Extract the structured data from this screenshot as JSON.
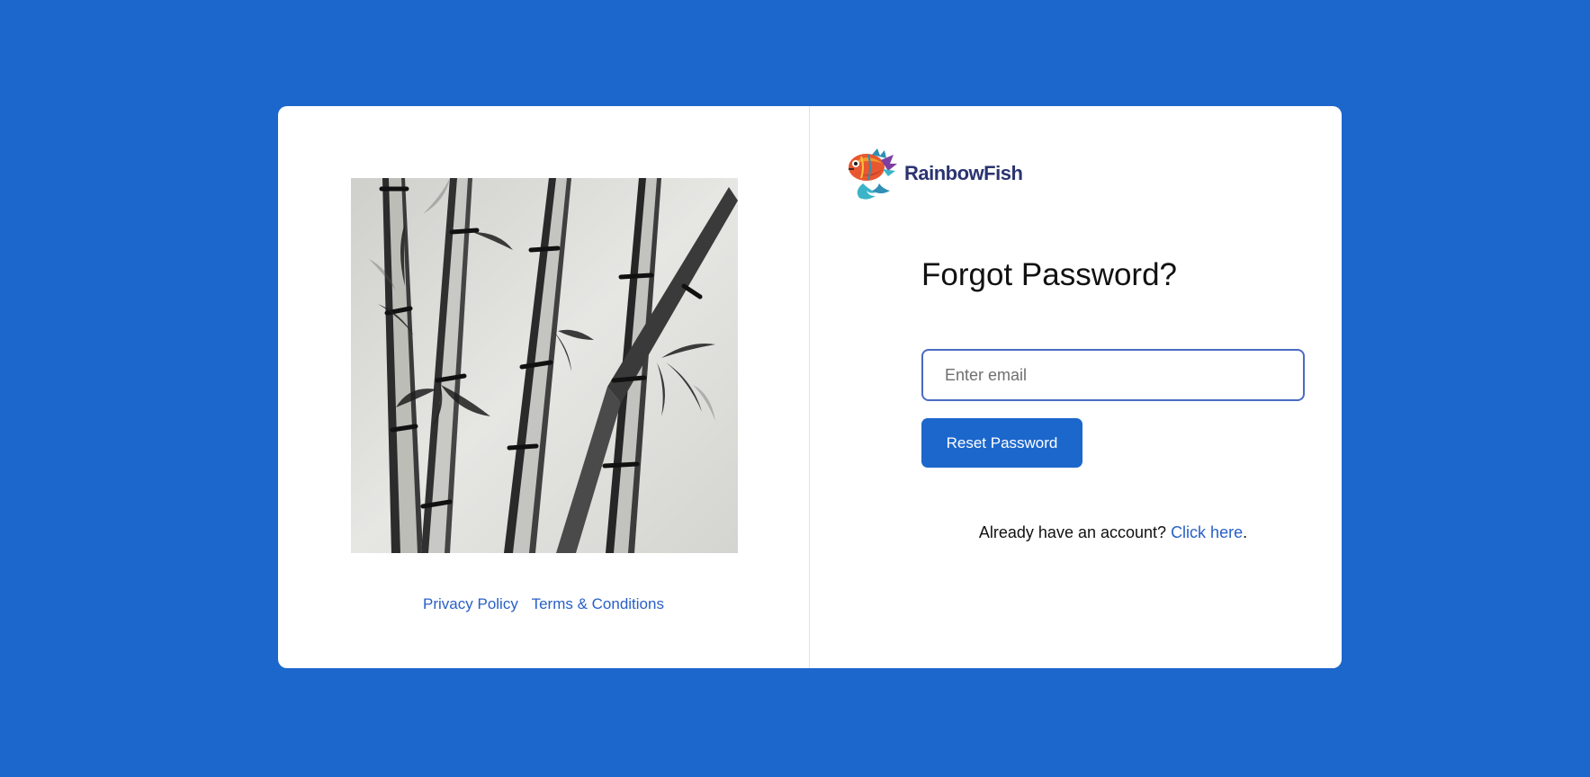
{
  "brand": {
    "name": "RainbowFish",
    "logo_icon": "fish-logo-icon"
  },
  "form": {
    "title": "Forgot Password?",
    "email_placeholder": "Enter email",
    "email_value": "",
    "submit_label": "Reset Password"
  },
  "account": {
    "prompt": "Already have an account?",
    "link_label": "Click here",
    "suffix": "."
  },
  "footer": {
    "privacy_label": "Privacy Policy",
    "terms_label": "Terms & Conditions"
  },
  "colors": {
    "background": "#1c67cc",
    "accent": "#1c67cc",
    "link": "#2960c6",
    "brand_text": "#2b3470"
  },
  "artwork": {
    "subject": "bamboo-ink-painting"
  }
}
